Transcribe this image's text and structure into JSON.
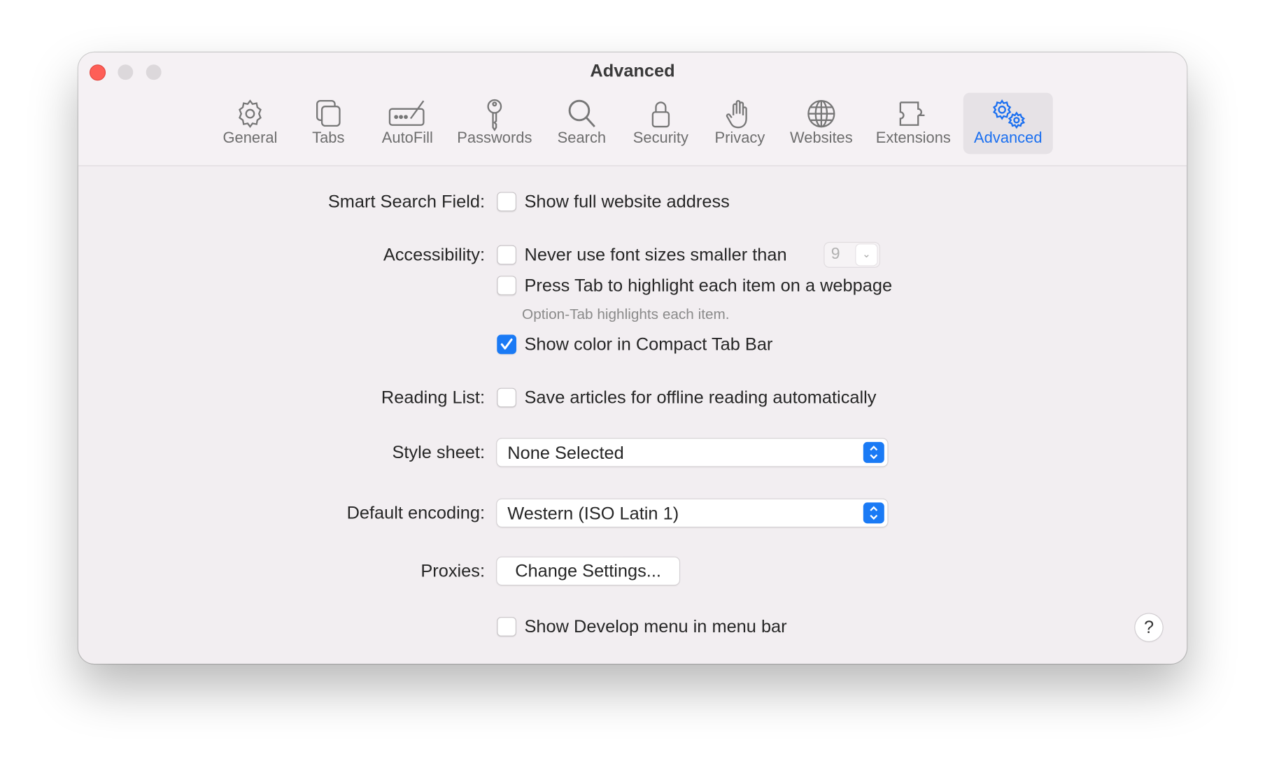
{
  "window": {
    "title": "Advanced"
  },
  "toolbar": {
    "tabs": [
      {
        "label": "General",
        "icon": "gear-icon"
      },
      {
        "label": "Tabs",
        "icon": "tabs-icon"
      },
      {
        "label": "AutoFill",
        "icon": "autofill-icon"
      },
      {
        "label": "Passwords",
        "icon": "key-icon"
      },
      {
        "label": "Search",
        "icon": "search-icon"
      },
      {
        "label": "Security",
        "icon": "lock-icon"
      },
      {
        "label": "Privacy",
        "icon": "hand-icon"
      },
      {
        "label": "Websites",
        "icon": "globe-icon"
      },
      {
        "label": "Extensions",
        "icon": "puzzle-icon"
      },
      {
        "label": "Advanced",
        "icon": "gears-icon",
        "selected": true
      }
    ]
  },
  "settings": {
    "smart_search": {
      "label": "Smart Search Field:",
      "option": "Show full website address",
      "checked": false
    },
    "accessibility": {
      "label": "Accessibility:",
      "font_size": {
        "option": "Never use font sizes smaller than",
        "checked": false,
        "value": "9"
      },
      "tab_highlight": {
        "option": "Press Tab to highlight each item on a webpage",
        "checked": false,
        "hint": "Option-Tab highlights each item."
      },
      "compact_color": {
        "option": "Show color in Compact Tab Bar",
        "checked": true
      }
    },
    "reading_list": {
      "label": "Reading List:",
      "option": "Save articles for offline reading automatically",
      "checked": false
    },
    "style_sheet": {
      "label": "Style sheet:",
      "value": "None Selected"
    },
    "encoding": {
      "label": "Default encoding:",
      "value": "Western (ISO Latin 1)"
    },
    "proxies": {
      "label": "Proxies:",
      "button": "Change Settings..."
    },
    "develop": {
      "option": "Show Develop menu in menu bar",
      "checked": false
    }
  },
  "help": {
    "label": "?"
  },
  "colors": {
    "accent": "#1a7af5",
    "close": "#fe5f57"
  }
}
